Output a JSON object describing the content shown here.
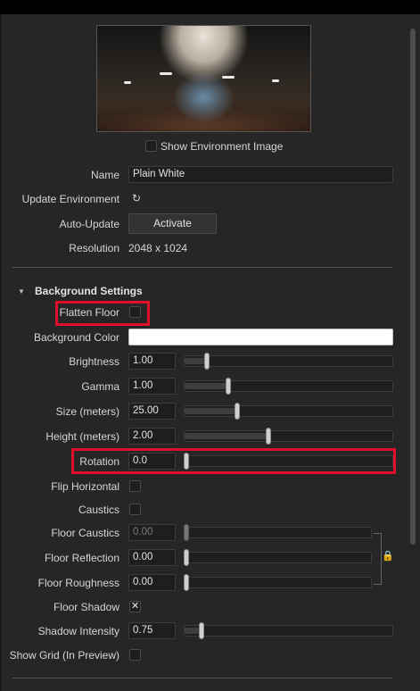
{
  "environment": {
    "show_image_label": "Show Environment Image",
    "name_label": "Name",
    "name_value": "Plain White",
    "update_label": "Update Environment",
    "update_icon": "refresh-icon",
    "auto_update_label": "Auto-Update",
    "activate_button": "Activate",
    "resolution_label": "Resolution",
    "resolution_value": "2048 x 1024"
  },
  "background": {
    "section_title": "Background Settings",
    "flatten_floor_label": "Flatten Floor",
    "background_color_label": "Background Color",
    "background_color_value": "#ffffff",
    "brightness": {
      "label": "Brightness",
      "value": "1.00",
      "level": 0.1
    },
    "gamma": {
      "label": "Gamma",
      "value": "1.00",
      "level": 0.21
    },
    "size": {
      "label": "Size (meters)",
      "value": "25.00",
      "level": 0.25
    },
    "height": {
      "label": "Height (meters)",
      "value": "2.00",
      "level": 0.4
    },
    "rotation": {
      "label": "Rotation",
      "value": "0.0",
      "level": 0.0
    },
    "flip_horizontal_label": "Flip Horizontal",
    "caustics_label": "Caustics",
    "floor_caustics": {
      "label": "Floor Caustics",
      "value": "0.00",
      "level": 0.0
    },
    "floor_reflection": {
      "label": "Floor Reflection",
      "value": "0.00",
      "level": 0.0
    },
    "floor_roughness": {
      "label": "Floor Roughness",
      "value": "0.00",
      "level": 0.0
    },
    "floor_shadow_label": "Floor Shadow",
    "floor_shadow_check": "✕",
    "shadow_intensity": {
      "label": "Shadow Intensity",
      "value": "0.75",
      "level": 0.08
    },
    "show_grid_label": "Show Grid (In Preview)"
  },
  "colors": {
    "highlight": "#e0102a",
    "panel": "#262626"
  }
}
